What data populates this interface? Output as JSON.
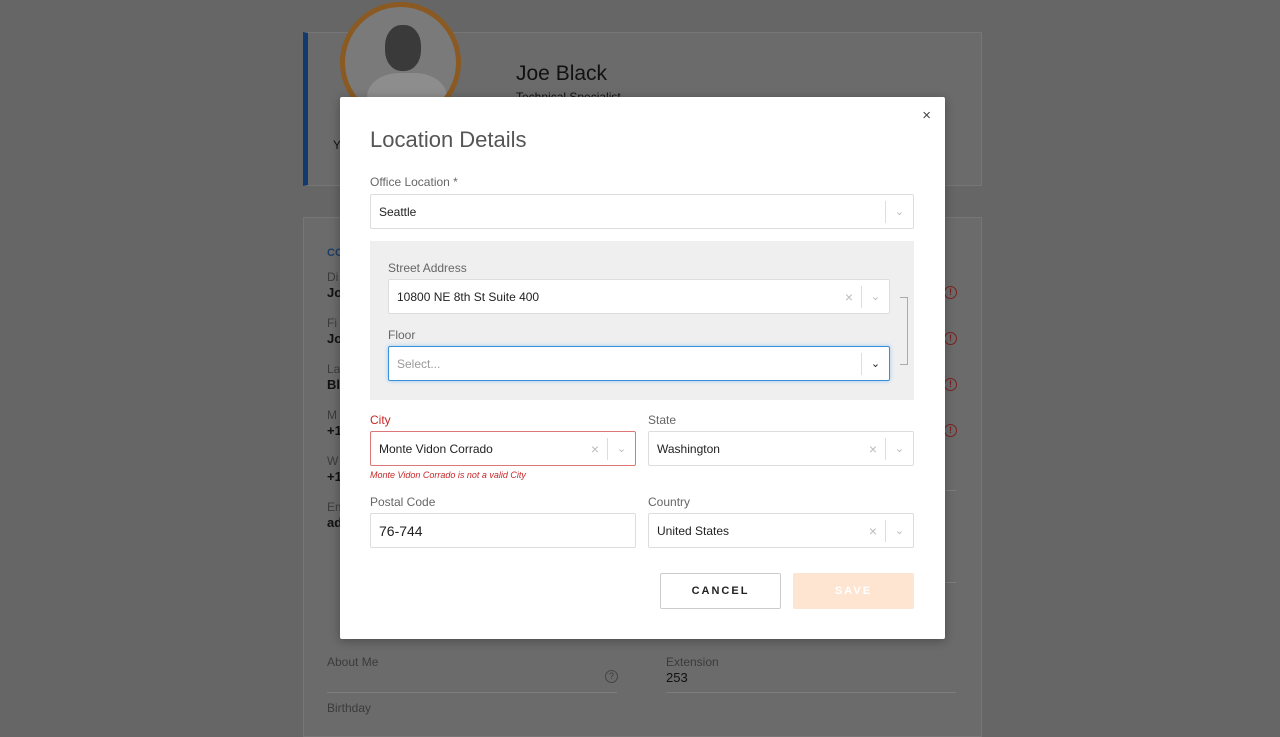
{
  "background": {
    "profile": {
      "name": "Joe Black",
      "title": "Technical Specialist",
      "left_fragment": "Y"
    },
    "contact": {
      "header_fragment": "CO",
      "rows": [
        {
          "label": "Di",
          "value": "Jo"
        },
        {
          "label": "Fi",
          "value": "Jo"
        },
        {
          "label": "La",
          "value": "Bl"
        },
        {
          "label": "M",
          "value": "+1"
        },
        {
          "label": "W",
          "value": "+1"
        },
        {
          "label": "Em",
          "value": "ad"
        }
      ]
    },
    "additional": {
      "about_label": "About Me",
      "birthday_label": "Birthday"
    },
    "other": {
      "extension_label": "Extension",
      "extension_value": "253"
    }
  },
  "modal": {
    "title": "Location Details",
    "close": "×",
    "office_location": {
      "label": "Office Location *",
      "value": "Seattle"
    },
    "street_address": {
      "label": "Street Address",
      "value": "10800 NE 8th St Suite 400"
    },
    "floor": {
      "label": "Floor",
      "placeholder": "Select..."
    },
    "city": {
      "label": "City",
      "value": "Monte Vidon Corrado",
      "error": "Monte Vidon Corrado is not a valid City"
    },
    "state": {
      "label": "State",
      "value": "Washington"
    },
    "postal_code": {
      "label": "Postal Code",
      "value": "76-744"
    },
    "country": {
      "label": "Country",
      "value": "United States"
    },
    "cancel_label": "CANCEL",
    "save_label": "SAVE",
    "clear_glyph": "×",
    "chevron_glyph": "⌄"
  },
  "colors": {
    "focus": "#3c8fd8",
    "error": "#c62828",
    "save_disabled": "#fde5d2",
    "accent_ring": "#e8912e"
  }
}
